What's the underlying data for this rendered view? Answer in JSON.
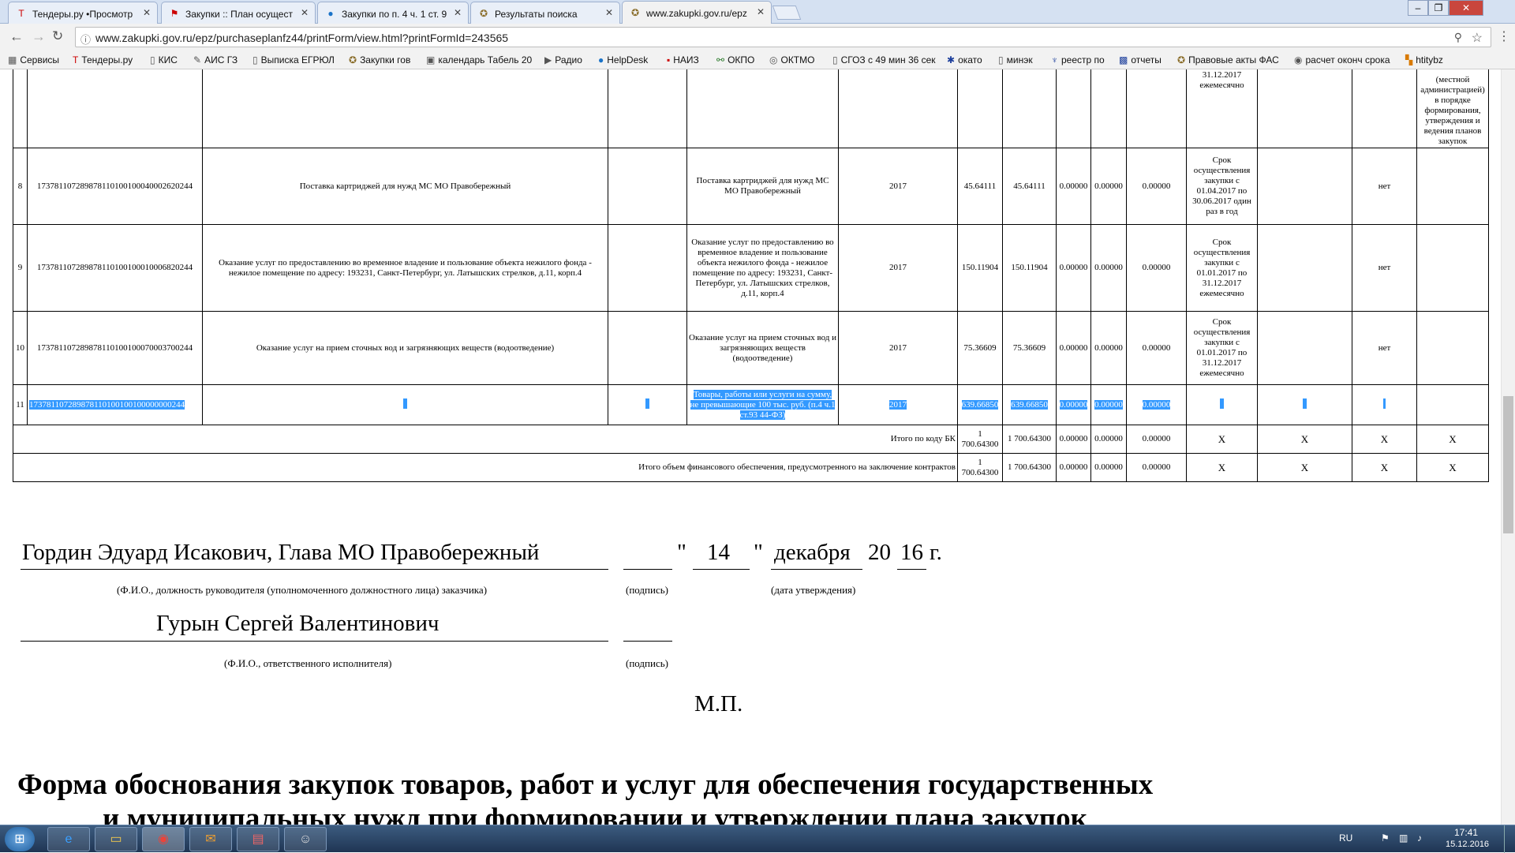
{
  "tabs": [
    {
      "title": "Тендеры.ру •Просмотр",
      "icon": "T"
    },
    {
      "title": "Закупки :: План осущест",
      "icon": "⚑"
    },
    {
      "title": "Закупки по п. 4 ч. 1 ст. 9",
      "icon": "●"
    },
    {
      "title": "Результаты поиска",
      "icon": "✪"
    },
    {
      "title": "www.zakupki.gov.ru/epz",
      "icon": "✪"
    }
  ],
  "url": "www.zakupki.gov.ru/epz/purchaseplanfz44/printForm/view.html?printFormId=243565",
  "bookmarks": [
    "Сервисы",
    "Тендеры.ру",
    "КИС",
    "АИС ГЗ",
    "Выписка ЕГРЮЛ",
    "Закупки гов",
    "календарь Табель 20",
    "Радио",
    "HelpDesk",
    "НАИЗ",
    "ОКПО",
    "ОКТМО",
    "СГОЗ с 49 мин 36 сек",
    "окато",
    "минэк",
    "реестр по",
    "отчеты",
    "Правовые акты ФАС",
    "расчет оконч срока",
    "htitybz"
  ],
  "top_row": {
    "deadline": "31.12.2017 ежемесячно",
    "note": "(местной администрацией) в порядке формирования, утверждения и ведения планов закупок"
  },
  "rows": [
    {
      "num": "8",
      "ikz": "173781107289878110100100040002620244",
      "name": "Поставка картриджей для нужд МС МО Правобережный",
      "obj": "Поставка картриджей для нужд МС МО Правобережный",
      "year": "2017",
      "total": "45.64111",
      "cur": "45.64111",
      "y1": "0.00000",
      "y2": "0.00000",
      "next": "0.00000",
      "term": "Срок осуществления закупки с 01.04.2017 по 30.06.2017 один раз в год",
      "discuss": "нет"
    },
    {
      "num": "9",
      "ikz": "173781107289878110100100010006820244",
      "name": "Оказание услуг по предоставлению во временное владение и пользование объекта нежилого фонда - нежилое помещение по адресу: 193231, Санкт-Петербург, ул. Латышских стрелков, д.11, корп.4",
      "obj": "Оказание услуг по предоставлению во временное владение и пользование объекта нежилого фонда - нежилое помещение по адресу: 193231, Санкт-Петербург, ул. Латышских стрелков, д.11, корп.4",
      "year": "2017",
      "total": "150.11904",
      "cur": "150.11904",
      "y1": "0.00000",
      "y2": "0.00000",
      "next": "0.00000",
      "term": "Срок осуществления закупки с 01.01.2017 по 31.12.2017 ежемесячно",
      "discuss": "нет"
    },
    {
      "num": "10",
      "ikz": "173781107289878110100100070003700244",
      "name": "Оказание услуг на прием сточных вод и загрязняющих веществ (водоотведение)",
      "obj": "Оказание услуг на прием сточных вод и загрязняющих веществ (водоотведение)",
      "year": "2017",
      "total": "75.36609",
      "cur": "75.36609",
      "y1": "0.00000",
      "y2": "0.00000",
      "next": "0.00000",
      "term": "Срок осуществления закупки с 01.01.2017 по 31.12.2017 ежемесячно",
      "discuss": "нет"
    }
  ],
  "row11": {
    "num": "11",
    "ikz": "173781107289878110100100100000000244",
    "obj": "Товары, работы или услуги на сумму, не превышающие 100 тыс. руб. (п.4 ч.1 ст.93 44-ФЗ)",
    "year": "2017",
    "total": "639.66850",
    "cur": "639.66850",
    "y1": "0.00000",
    "y2": "0.00000",
    "next": "0.00000"
  },
  "totals": [
    {
      "label": "Итого по коду БК",
      "total": "1 700.64300",
      "cur": "1 700.64300",
      "y1": "0.00000",
      "y2": "0.00000",
      "next": "0.00000",
      "x": "X"
    },
    {
      "label": "Итого объем финансового обеспечения, предусмотренного на заключение контрактов",
      "total": "1 700.64300",
      "cur": "1 700.64300",
      "y1": "0.00000",
      "y2": "0.00000",
      "next": "0.00000",
      "x": "X"
    }
  ],
  "signature": {
    "head_name": "Гордин Эдуард Исакович, Глава МО Правобережный",
    "quote_open": "\"",
    "day": "14",
    "quote_close": "\"",
    "month": "декабря",
    "year_prefix": "20",
    "year_suffix": "16",
    "year_unit": "г.",
    "head_caption": "(Ф.И.О., должность руководителя (уполномоченного должностного лица) заказчика)",
    "sign_caption": "(подпись)",
    "date_caption": "(дата утверждения)",
    "exec_name": "Гурын Сергей Валентинович",
    "exec_caption": "(Ф.И.О., ответственного исполнителя)",
    "mp": "М.П."
  },
  "heading_line1": "Форма обоснования закупок товаров, работ и услуг для обеспечения государственных",
  "heading_line2": "и муниципальных нужд при формировании и утверждении плана закупок",
  "tray": {
    "lang": "RU",
    "time": "17:41",
    "date": "15.12.2016"
  }
}
